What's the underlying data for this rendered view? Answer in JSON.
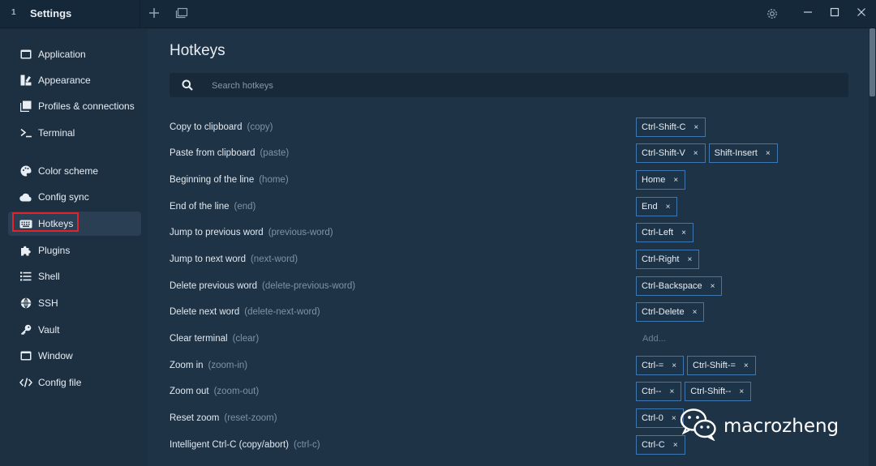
{
  "titlebar": {
    "app_icon_text": "1",
    "title": "Settings",
    "icons": [
      "plus-icon",
      "window-icon",
      "gear-icon",
      "minimize-icon",
      "maximize-icon",
      "close-icon"
    ]
  },
  "sidebar": {
    "items": [
      {
        "label": "Application",
        "icon": "application-icon"
      },
      {
        "label": "Appearance",
        "icon": "appearance-icon"
      },
      {
        "label": "Profiles & connections",
        "icon": "profiles-icon"
      },
      {
        "label": "Terminal",
        "icon": "terminal-icon"
      },
      {
        "label": "Color scheme",
        "icon": "palette-icon"
      },
      {
        "label": "Config sync",
        "icon": "cloud-icon"
      },
      {
        "label": "Hotkeys",
        "icon": "keyboard-icon",
        "active": true
      },
      {
        "label": "Plugins",
        "icon": "puzzle-icon"
      },
      {
        "label": "Shell",
        "icon": "list-icon"
      },
      {
        "label": "SSH",
        "icon": "globe-icon"
      },
      {
        "label": "Vault",
        "icon": "key-icon"
      },
      {
        "label": "Window",
        "icon": "window-icon"
      },
      {
        "label": "Config file",
        "icon": "code-icon"
      }
    ]
  },
  "main": {
    "title": "Hotkeys",
    "search_placeholder": "Search hotkeys",
    "add_label": "Add...",
    "rows": [
      {
        "label": "Copy to clipboard",
        "id": "(copy)",
        "keys": [
          "Ctrl-Shift-C"
        ]
      },
      {
        "label": "Paste from clipboard",
        "id": "(paste)",
        "keys": [
          "Ctrl-Shift-V",
          "Shift-Insert"
        ]
      },
      {
        "label": "Beginning of the line",
        "id": "(home)",
        "keys": [
          "Home"
        ]
      },
      {
        "label": "End of the line",
        "id": "(end)",
        "keys": [
          "End"
        ]
      },
      {
        "label": "Jump to previous word",
        "id": "(previous-word)",
        "keys": [
          "Ctrl-Left"
        ]
      },
      {
        "label": "Jump to next word",
        "id": "(next-word)",
        "keys": [
          "Ctrl-Right"
        ]
      },
      {
        "label": "Delete previous word",
        "id": "(delete-previous-word)",
        "keys": [
          "Ctrl-Backspace"
        ]
      },
      {
        "label": "Delete next word",
        "id": "(delete-next-word)",
        "keys": [
          "Ctrl-Delete"
        ]
      },
      {
        "label": "Clear terminal",
        "id": "(clear)",
        "keys": []
      },
      {
        "label": "Zoom in",
        "id": "(zoom-in)",
        "keys": [
          "Ctrl-=",
          "Ctrl-Shift-="
        ]
      },
      {
        "label": "Zoom out",
        "id": "(zoom-out)",
        "keys": [
          "Ctrl--",
          "Ctrl-Shift--"
        ]
      },
      {
        "label": "Reset zoom",
        "id": "(reset-zoom)",
        "keys": [
          "Ctrl-0"
        ]
      },
      {
        "label": "Intelligent Ctrl-C (copy/abort)",
        "id": "(ctrl-c)",
        "keys": [
          "Ctrl-C"
        ]
      }
    ]
  },
  "watermark": {
    "text": "macrozheng"
  },
  "colors": {
    "background": "#1f3346",
    "titlebar": "#15283a",
    "key_border": "#3f78b0",
    "highlight_box": "#e0242a"
  }
}
